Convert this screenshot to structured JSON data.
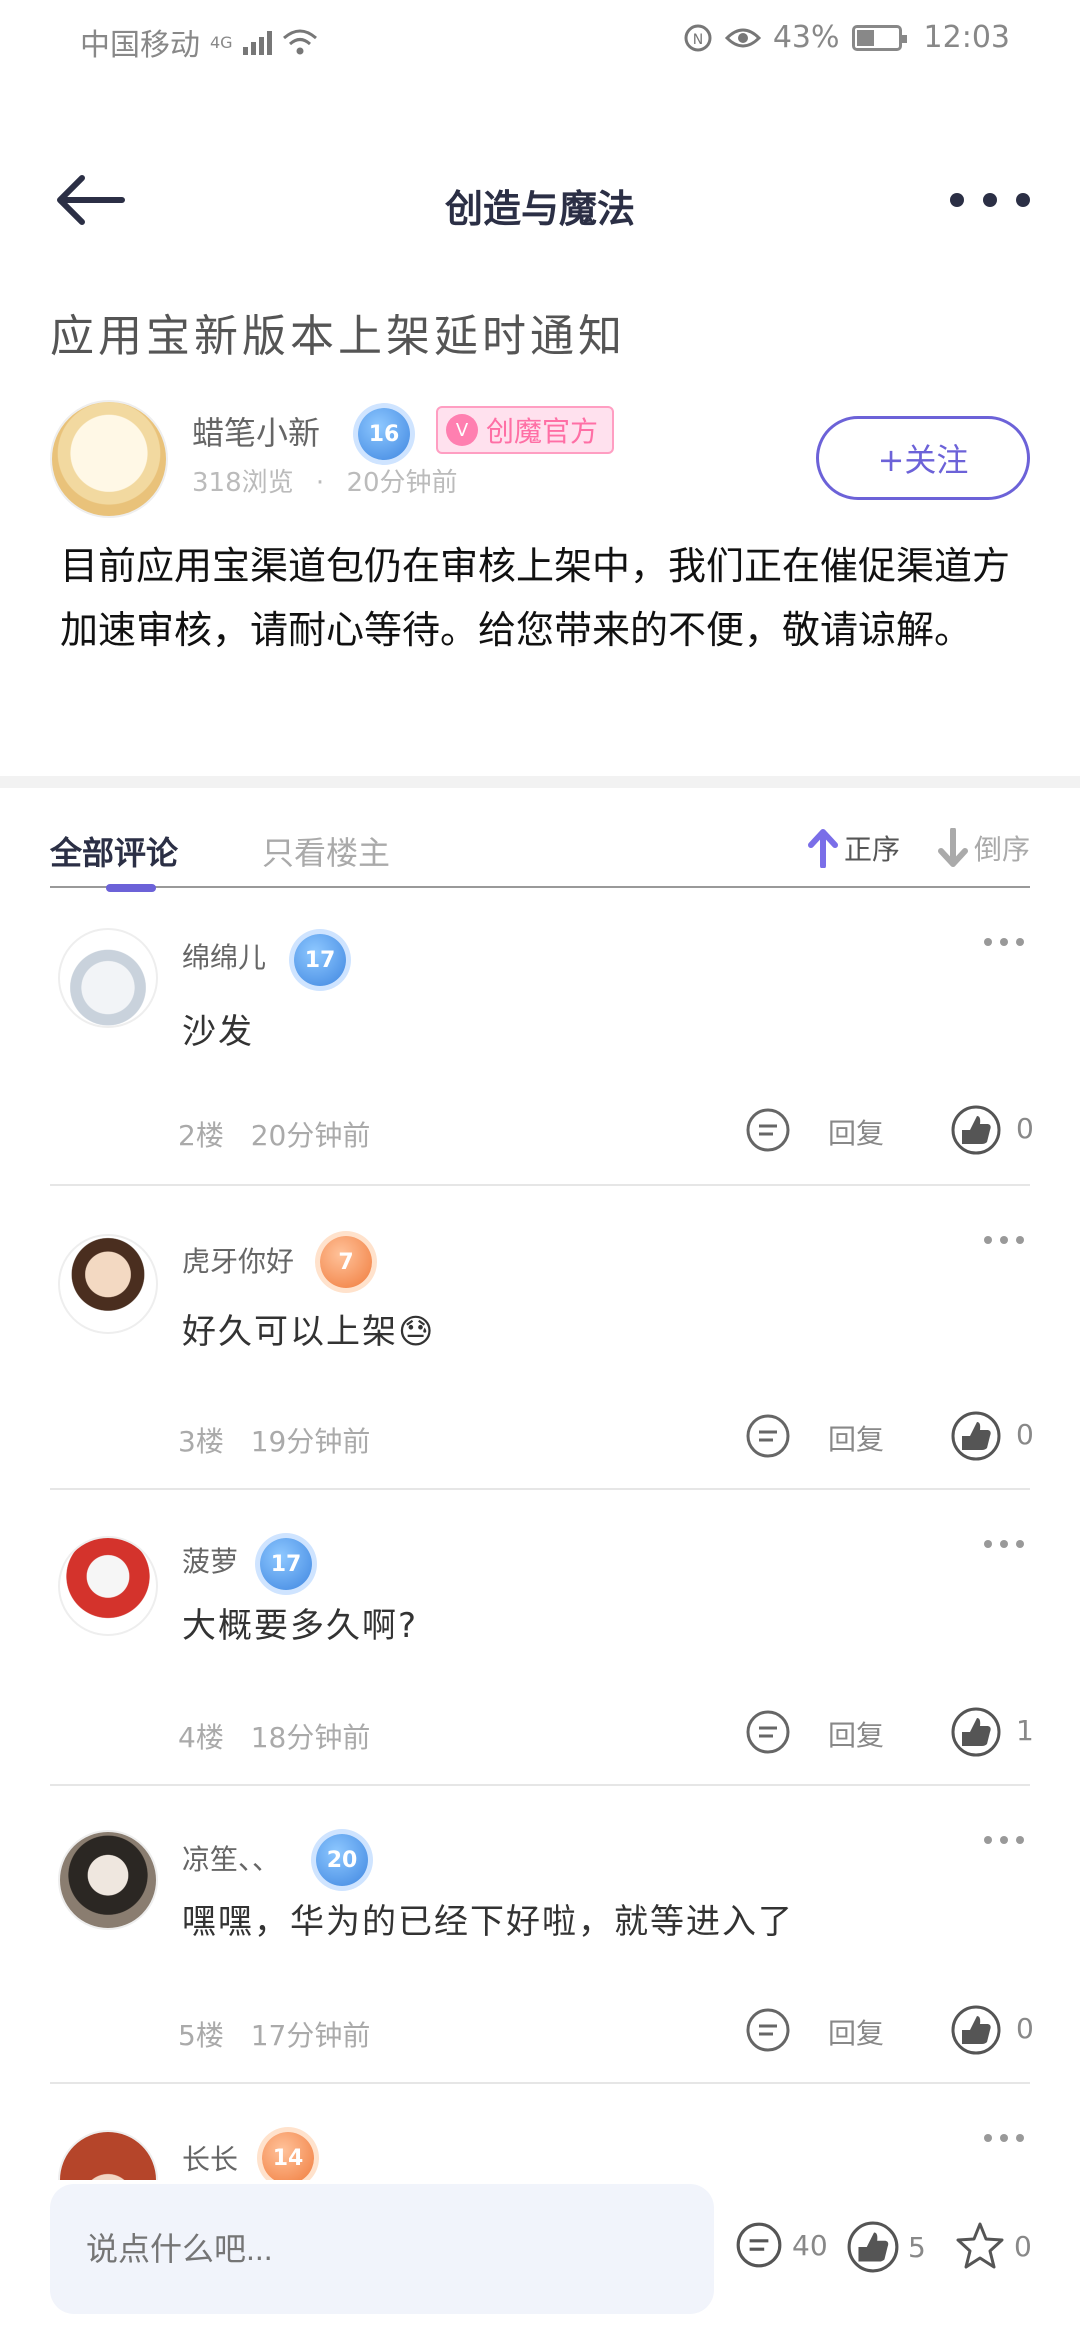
{
  "status_bar": {
    "carrier": "中国移动",
    "network": "4G",
    "battery_percent": "43%",
    "time": "12:03"
  },
  "header": {
    "title": "创造与魔法"
  },
  "post": {
    "title": "应用宝新版本上架延时通知",
    "author": {
      "name": "蜡笔小新",
      "level": "16",
      "official_badge": "创魔官方",
      "views": "318浏览",
      "time": "20分钟前"
    },
    "follow_label": "+关注",
    "body": "目前应用宝渠道包仍在审核上架中，我们正在催促渠道方加速审核，请耐心等待。给您带来的不便，敬请谅解。"
  },
  "tabs": {
    "all": "全部评论",
    "op_only": "只看楼主",
    "sort_asc": "正序",
    "sort_desc": "倒序"
  },
  "comments": [
    {
      "name": "绵绵儿",
      "level": "17",
      "level_color": "blue",
      "text": "沙发",
      "floor": "2楼",
      "time": "20分钟前",
      "reply": "回复",
      "likes": "0"
    },
    {
      "name": "虎牙你好",
      "level": "7",
      "level_color": "orange",
      "text": "好久可以上架😓",
      "floor": "3楼",
      "time": "19分钟前",
      "reply": "回复",
      "likes": "0"
    },
    {
      "name": "菠萝",
      "level": "17",
      "level_color": "blue",
      "text": "大概要多久啊?",
      "floor": "4楼",
      "time": "18分钟前",
      "reply": "回复",
      "likes": "1"
    },
    {
      "name": "凉笙、、",
      "level": "20",
      "level_color": "blue",
      "text": "嘿嘿，华为的已经下好啦，就等进入了",
      "floor": "5楼",
      "time": "17分钟前",
      "reply": "回复",
      "likes": "0"
    },
    {
      "name": "长长",
      "level": "14",
      "level_color": "orange"
    }
  ],
  "bottom_bar": {
    "input_placeholder": "说点什么吧...",
    "comment_count": "40",
    "like_count": "5",
    "favorite_count": "0"
  },
  "colors": {
    "accent": "#6c62d8",
    "official_pink": "#ff6fa5",
    "title_dark": "#2b2f45"
  }
}
